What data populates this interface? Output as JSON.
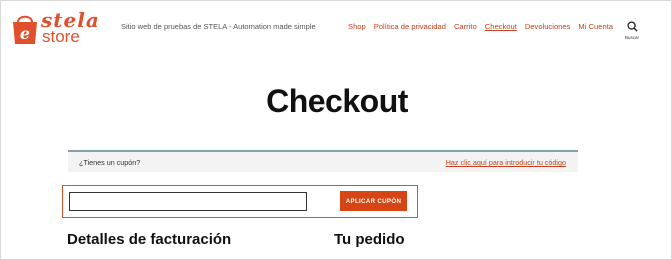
{
  "brand": {
    "name_top": "stela",
    "name_bottom": "store",
    "accent": "#e0502c"
  },
  "header": {
    "tagline": "Sitio web de pruebas de STELA - Automation made simple",
    "nav": [
      {
        "label": "Shop",
        "active": false
      },
      {
        "label": "Política de privacidad",
        "active": false
      },
      {
        "label": "Carrito",
        "active": false
      },
      {
        "label": "Checkout",
        "active": true
      },
      {
        "label": "Devoluciones",
        "active": false
      },
      {
        "label": "Mi Cuenta",
        "active": false
      }
    ],
    "search_label": "Buscar",
    "nav_color": "#c5411d"
  },
  "main": {
    "title": "Checkout",
    "coupon_notice": {
      "question": "¿Tienes un cupón?",
      "link": "Haz clic aquí para introducir tu código"
    },
    "coupon_form": {
      "input_value": "",
      "button_label": "APLICAR CUPÓN",
      "button_color": "#d64513"
    },
    "billing_heading": "Detalles de facturación",
    "order_heading": "Tu pedido"
  }
}
